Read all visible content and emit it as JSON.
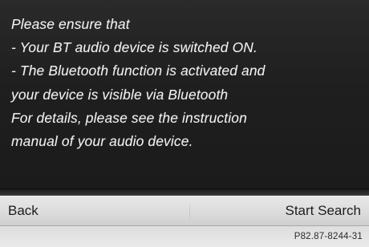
{
  "message": {
    "lines": [
      "Please ensure that",
      " - Your BT audio device is switched ON.",
      " - The Bluetooth function is activated and",
      "your device is visible via Bluetooth",
      "For details, please see the instruction",
      "manual of your audio device."
    ]
  },
  "buttons": {
    "back_label": "Back",
    "start_search_label": "Start Search"
  },
  "footer": {
    "reference": "P82.87-8244-31"
  },
  "colors": {
    "message_background": "#1f1f1f",
    "message_text": "#f2f2f2",
    "button_bar": "#dcdcdc",
    "button_text": "#1d1d1d"
  }
}
